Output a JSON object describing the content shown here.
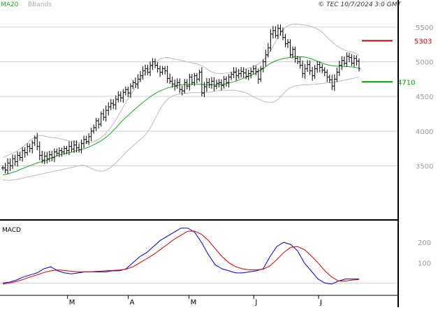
{
  "header": {
    "legend_ma": "MA20",
    "legend_bbands": "BBands",
    "copyright": "© TEC 10/7/2024 3:0 GMT"
  },
  "colors": {
    "ma": "#22aa22",
    "bbands": "#bbbbbb",
    "bars": "#000000",
    "resistance": "#cc0000",
    "support": "#009900",
    "macd": "#0000cc",
    "signal": "#cc0000",
    "grid": "#d0d0d0",
    "axis_text": "#999999"
  },
  "chart_data": [
    {
      "type": "ohlc",
      "name": "price",
      "ylim": [
        2750,
        5750
      ],
      "y_ticks": [
        3500,
        4000,
        4500,
        5000,
        5500
      ],
      "y_tick_labels": [
        "3500",
        "4000",
        "4500",
        "5000",
        "5500"
      ],
      "grid": true,
      "levels": [
        {
          "label": "5303",
          "value": 5303,
          "kind": "resistance"
        },
        {
          "label": "4710",
          "value": 4710,
          "kind": "support"
        }
      ],
      "closes": [
        3470,
        3440,
        3540,
        3500,
        3600,
        3560,
        3650,
        3620,
        3720,
        3690,
        3780,
        3750,
        3830,
        3900,
        3780,
        3650,
        3580,
        3640,
        3600,
        3660,
        3620,
        3700,
        3680,
        3720,
        3700,
        3750,
        3720,
        3780,
        3740,
        3800,
        3760,
        3730,
        3820,
        3880,
        3850,
        3920,
        4000,
        4050,
        4150,
        4100,
        4250,
        4200,
        4300,
        4350,
        4400,
        4380,
        4460,
        4520,
        4480,
        4560,
        4600,
        4550,
        4650,
        4700,
        4680,
        4750,
        4800,
        4870,
        4900,
        4850,
        4950,
        5000,
        4950,
        4900,
        4850,
        4900,
        4870,
        4760,
        4720,
        4680,
        4650,
        4700,
        4600,
        4580,
        4700,
        4650,
        4780,
        4700,
        4800,
        4750,
        4850,
        4550,
        4640,
        4700,
        4670,
        4720,
        4650,
        4690,
        4700,
        4660,
        4750,
        4700,
        4780,
        4820,
        4850,
        4800,
        4830,
        4860,
        4840,
        4790,
        4830,
        4860,
        4900,
        4860,
        4750,
        4900,
        5000,
        5100,
        5200,
        5400,
        5450,
        5380,
        5480,
        5440,
        5350,
        5260,
        5280,
        5100,
        5180,
        5050,
        5000,
        4950,
        4830,
        4900,
        4960,
        4870,
        4800,
        4900,
        4960,
        4920,
        4880,
        4850,
        4780,
        4740,
        4650,
        4750,
        4850,
        4950,
        5020,
        4980,
        5080,
        5060,
        4980,
        5050,
        5010,
        4900
      ],
      "ma20": [
        3370,
        3375,
        3385,
        3395,
        3410,
        3420,
        3440,
        3455,
        3470,
        3485,
        3500,
        3515,
        3530,
        3545,
        3555,
        3560,
        3575,
        3590,
        3610,
        3625,
        3640,
        3655,
        3665,
        3675,
        3685,
        3690,
        3700,
        3715,
        3725,
        3735,
        3745,
        3755,
        3770,
        3785,
        3805,
        3825,
        3845,
        3870,
        3895,
        3925,
        3960,
        4000,
        4040,
        4080,
        4125,
        4165,
        4200,
        4235,
        4270,
        4305,
        4340,
        4375,
        4405,
        4435,
        4465,
        4495,
        4520,
        4545,
        4565,
        4585,
        4600,
        4615,
        4630,
        4640,
        4650,
        4660,
        4665,
        4670,
        4672,
        4673,
        4674,
        4675,
        4676,
        4675,
        4674,
        4672,
        4670,
        4668,
        4668,
        4669,
        4670,
        4672,
        4675,
        4680,
        4690,
        4700,
        4710,
        4720,
        4735,
        4750,
        4765,
        4780,
        4795,
        4810,
        4830,
        4850,
        4875,
        4900,
        4925,
        4955,
        4980,
        5000,
        5015,
        5030,
        5040,
        5050,
        5055,
        5060,
        5065,
        5070,
        5072,
        5072,
        5070,
        5065,
        5055,
        5045,
        5030,
        5015,
        5000,
        4985,
        4970,
        4960,
        4950,
        4945,
        4940,
        4938,
        4935,
        4932,
        4930,
        4930,
        4928,
        4922,
        4915,
        4910
      ],
      "bb_upper": [
        3620,
        3640,
        3660,
        3680,
        3700,
        3730,
        3760,
        3800,
        3840,
        3880,
        3910,
        3930,
        3940,
        3930,
        3920,
        3910,
        3905,
        3900,
        3890,
        3880,
        3870,
        3860,
        3850,
        3840,
        3835,
        3830,
        3830,
        3835,
        3840,
        3860,
        3880,
        3910,
        3950,
        4000,
        4060,
        4120,
        4200,
        4280,
        4360,
        4440,
        4510,
        4580,
        4650,
        4720,
        4790,
        4850,
        4900,
        4950,
        4990,
        5030,
        5050,
        5060,
        5060,
        5050,
        5040,
        5030,
        5020,
        5010,
        5000,
        4990,
        4980,
        4970,
        4950,
        4930,
        4900,
        4870,
        4850,
        4835,
        4830,
        4830,
        4835,
        4840,
        4850,
        4860,
        4870,
        4880,
        4890,
        4905,
        4920,
        4940,
        4960,
        4990,
        5030,
        5080,
        5150,
        5230,
        5310,
        5390,
        5450,
        5500,
        5530,
        5540,
        5545,
        5540,
        5535,
        5530,
        5520,
        5510,
        5490,
        5470,
        5440,
        5400,
        5350,
        5310,
        5270,
        5230,
        5200,
        5180,
        5160,
        5150,
        5140,
        5120,
        5090
      ],
      "bb_lower": [
        3300,
        3295,
        3290,
        3295,
        3300,
        3310,
        3320,
        3330,
        3340,
        3350,
        3360,
        3370,
        3380,
        3390,
        3400,
        3410,
        3420,
        3430,
        3440,
        3450,
        3460,
        3470,
        3480,
        3490,
        3500,
        3510,
        3500,
        3480,
        3460,
        3440,
        3430,
        3420,
        3430,
        3450,
        3480,
        3520,
        3560,
        3610,
        3660,
        3710,
        3750,
        3790,
        3830,
        3870,
        3910,
        3960,
        4020,
        4100,
        4190,
        4280,
        4360,
        4420,
        4470,
        4500,
        4520,
        4530,
        4540,
        4545,
        4550,
        4555,
        4555,
        4555,
        4555,
        4560,
        4560,
        4560,
        4570,
        4580,
        4585,
        4590,
        4590,
        4590,
        4590,
        4590,
        4580,
        4570,
        4560,
        4540,
        4515,
        4490,
        4470,
        4450,
        4430,
        4420,
        4415,
        4420,
        4440,
        4480,
        4530,
        4580,
        4620,
        4640,
        4650,
        4660,
        4665,
        4668,
        4670,
        4672,
        4675,
        4680,
        4685,
        4690,
        4695,
        4700,
        4705,
        4715,
        4720,
        4730,
        4740,
        4750,
        4760,
        4770,
        4780
      ],
      "x_month_labels": [
        "M",
        "A",
        "M",
        "J",
        "J"
      ],
      "x_month_positions": [
        32,
        62,
        92,
        124,
        156
      ]
    },
    {
      "type": "line",
      "name": "MACD",
      "title": "MACD",
      "ylim": [
        -50,
        300
      ],
      "y_ticks": [
        100,
        200
      ],
      "y_tick_labels": [
        "100",
        "200"
      ],
      "series": [
        {
          "name": "MACD",
          "values": [
            0,
            5,
            15,
            30,
            40,
            50,
            70,
            80,
            60,
            50,
            45,
            50,
            55,
            55,
            55,
            55,
            60,
            60,
            70,
            100,
            130,
            150,
            180,
            210,
            230,
            250,
            270,
            270,
            250,
            200,
            140,
            90,
            70,
            60,
            50,
            50,
            55,
            60,
            70,
            130,
            180,
            200,
            190,
            160,
            100,
            60,
            20,
            0,
            -5,
            10,
            20,
            20,
            20
          ]
        },
        {
          "name": "Signal",
          "values": [
            -5,
            0,
            8,
            18,
            30,
            40,
            52,
            60,
            65,
            62,
            58,
            55,
            55,
            56,
            58,
            60,
            62,
            64,
            68,
            80,
            100,
            120,
            140,
            165,
            190,
            215,
            235,
            255,
            255,
            240,
            210,
            170,
            130,
            100,
            80,
            70,
            65,
            65,
            68,
            85,
            115,
            150,
            175,
            180,
            165,
            135,
            100,
            60,
            30,
            10,
            10,
            15,
            18
          ]
        }
      ]
    }
  ]
}
